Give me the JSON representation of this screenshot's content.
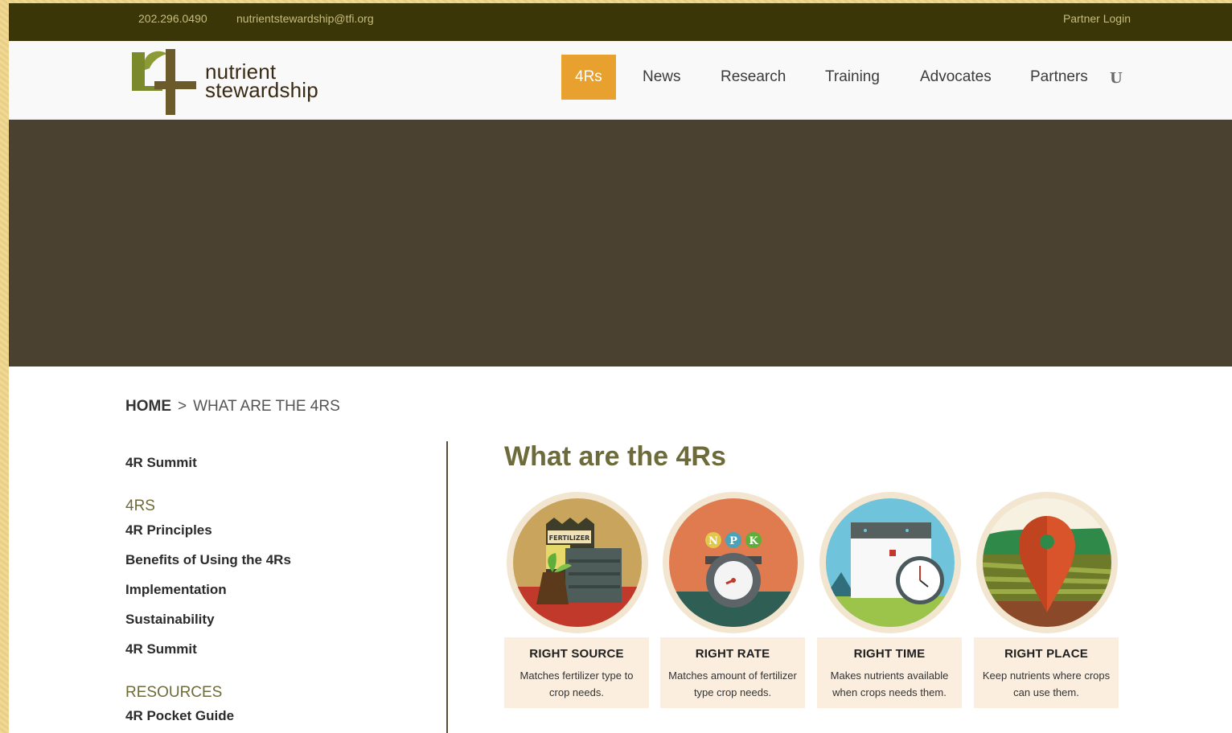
{
  "topbar": {
    "phone": "202.296.0490",
    "email": "nutrientstewardship@tfi.org",
    "partner_login": "Partner Login"
  },
  "logo": {
    "line1": "nutrient",
    "line2": "stewardship"
  },
  "nav": {
    "items": [
      "4Rs",
      "News",
      "Research",
      "Training",
      "Advocates",
      "Partners"
    ],
    "active": "4Rs",
    "extra_icon_glyph": "U"
  },
  "breadcrumb": {
    "home": "HOME",
    "separator": ">",
    "current": "WHAT ARE THE 4RS"
  },
  "sidebar": {
    "top_link": "4R Summit",
    "section_4rs": {
      "heading": "4RS",
      "links": [
        "4R Principles",
        "Benefits of Using the 4Rs",
        "Implementation",
        "Sustainability",
        "4R Summit"
      ]
    },
    "section_resources": {
      "heading": "RESOURCES",
      "links": [
        "4R Pocket Guide"
      ]
    }
  },
  "main": {
    "title": "What are the 4Rs",
    "cards": [
      {
        "title": "RIGHT SOURCE",
        "desc": "Matches fertilizer type to crop needs.",
        "icon": "fertilizer-bag-icon",
        "bag_label": "FERTILIZER"
      },
      {
        "title": "RIGHT RATE",
        "desc": "Matches amount of fertilizer type crop needs.",
        "icon": "scale-npk-icon",
        "npk": [
          "N",
          "P",
          "K"
        ]
      },
      {
        "title": "RIGHT TIME",
        "desc": "Makes nutrients available when crops needs them.",
        "icon": "calendar-clock-icon"
      },
      {
        "title": "RIGHT PLACE",
        "desc": "Keep nutrients where crops can use them.",
        "icon": "map-pin-field-icon"
      }
    ]
  },
  "colors": {
    "topbar_bg": "#3b3607",
    "active_nav": "#e8a02e",
    "hero_bg": "#4a4130",
    "accent_text": "#6e6b3a",
    "card_panel": "#fbeedf",
    "logo_green": "#7a8a2a",
    "logo_brown": "#6b5a2a"
  }
}
